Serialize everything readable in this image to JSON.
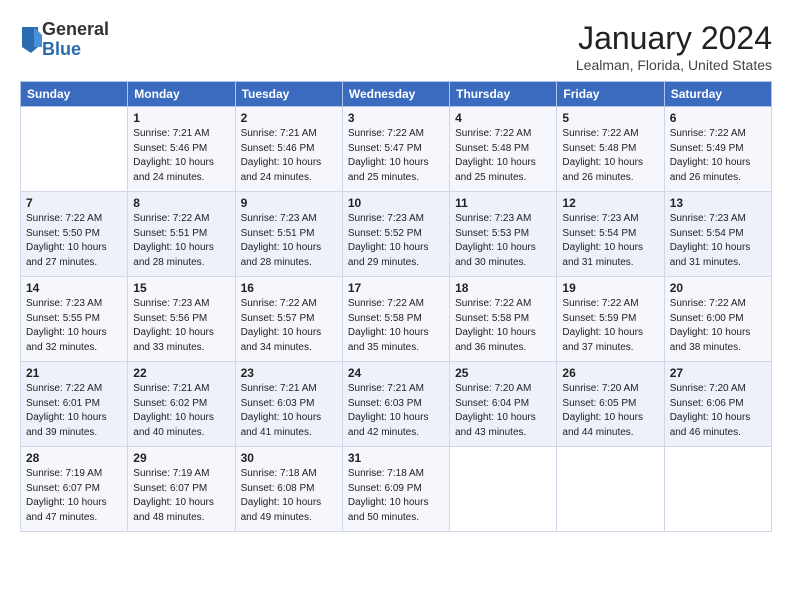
{
  "header": {
    "logo_general": "General",
    "logo_blue": "Blue",
    "month_title": "January 2024",
    "location": "Lealman, Florida, United States"
  },
  "days_of_week": [
    "Sunday",
    "Monday",
    "Tuesday",
    "Wednesday",
    "Thursday",
    "Friday",
    "Saturday"
  ],
  "weeks": [
    [
      {
        "day": "",
        "info": ""
      },
      {
        "day": "1",
        "info": "Sunrise: 7:21 AM\nSunset: 5:46 PM\nDaylight: 10 hours\nand 24 minutes."
      },
      {
        "day": "2",
        "info": "Sunrise: 7:21 AM\nSunset: 5:46 PM\nDaylight: 10 hours\nand 24 minutes."
      },
      {
        "day": "3",
        "info": "Sunrise: 7:22 AM\nSunset: 5:47 PM\nDaylight: 10 hours\nand 25 minutes."
      },
      {
        "day": "4",
        "info": "Sunrise: 7:22 AM\nSunset: 5:48 PM\nDaylight: 10 hours\nand 25 minutes."
      },
      {
        "day": "5",
        "info": "Sunrise: 7:22 AM\nSunset: 5:48 PM\nDaylight: 10 hours\nand 26 minutes."
      },
      {
        "day": "6",
        "info": "Sunrise: 7:22 AM\nSunset: 5:49 PM\nDaylight: 10 hours\nand 26 minutes."
      }
    ],
    [
      {
        "day": "7",
        "info": "Sunrise: 7:22 AM\nSunset: 5:50 PM\nDaylight: 10 hours\nand 27 minutes."
      },
      {
        "day": "8",
        "info": "Sunrise: 7:22 AM\nSunset: 5:51 PM\nDaylight: 10 hours\nand 28 minutes."
      },
      {
        "day": "9",
        "info": "Sunrise: 7:23 AM\nSunset: 5:51 PM\nDaylight: 10 hours\nand 28 minutes."
      },
      {
        "day": "10",
        "info": "Sunrise: 7:23 AM\nSunset: 5:52 PM\nDaylight: 10 hours\nand 29 minutes."
      },
      {
        "day": "11",
        "info": "Sunrise: 7:23 AM\nSunset: 5:53 PM\nDaylight: 10 hours\nand 30 minutes."
      },
      {
        "day": "12",
        "info": "Sunrise: 7:23 AM\nSunset: 5:54 PM\nDaylight: 10 hours\nand 31 minutes."
      },
      {
        "day": "13",
        "info": "Sunrise: 7:23 AM\nSunset: 5:54 PM\nDaylight: 10 hours\nand 31 minutes."
      }
    ],
    [
      {
        "day": "14",
        "info": "Sunrise: 7:23 AM\nSunset: 5:55 PM\nDaylight: 10 hours\nand 32 minutes."
      },
      {
        "day": "15",
        "info": "Sunrise: 7:23 AM\nSunset: 5:56 PM\nDaylight: 10 hours\nand 33 minutes."
      },
      {
        "day": "16",
        "info": "Sunrise: 7:22 AM\nSunset: 5:57 PM\nDaylight: 10 hours\nand 34 minutes."
      },
      {
        "day": "17",
        "info": "Sunrise: 7:22 AM\nSunset: 5:58 PM\nDaylight: 10 hours\nand 35 minutes."
      },
      {
        "day": "18",
        "info": "Sunrise: 7:22 AM\nSunset: 5:58 PM\nDaylight: 10 hours\nand 36 minutes."
      },
      {
        "day": "19",
        "info": "Sunrise: 7:22 AM\nSunset: 5:59 PM\nDaylight: 10 hours\nand 37 minutes."
      },
      {
        "day": "20",
        "info": "Sunrise: 7:22 AM\nSunset: 6:00 PM\nDaylight: 10 hours\nand 38 minutes."
      }
    ],
    [
      {
        "day": "21",
        "info": "Sunrise: 7:22 AM\nSunset: 6:01 PM\nDaylight: 10 hours\nand 39 minutes."
      },
      {
        "day": "22",
        "info": "Sunrise: 7:21 AM\nSunset: 6:02 PM\nDaylight: 10 hours\nand 40 minutes."
      },
      {
        "day": "23",
        "info": "Sunrise: 7:21 AM\nSunset: 6:03 PM\nDaylight: 10 hours\nand 41 minutes."
      },
      {
        "day": "24",
        "info": "Sunrise: 7:21 AM\nSunset: 6:03 PM\nDaylight: 10 hours\nand 42 minutes."
      },
      {
        "day": "25",
        "info": "Sunrise: 7:20 AM\nSunset: 6:04 PM\nDaylight: 10 hours\nand 43 minutes."
      },
      {
        "day": "26",
        "info": "Sunrise: 7:20 AM\nSunset: 6:05 PM\nDaylight: 10 hours\nand 44 minutes."
      },
      {
        "day": "27",
        "info": "Sunrise: 7:20 AM\nSunset: 6:06 PM\nDaylight: 10 hours\nand 46 minutes."
      }
    ],
    [
      {
        "day": "28",
        "info": "Sunrise: 7:19 AM\nSunset: 6:07 PM\nDaylight: 10 hours\nand 47 minutes."
      },
      {
        "day": "29",
        "info": "Sunrise: 7:19 AM\nSunset: 6:07 PM\nDaylight: 10 hours\nand 48 minutes."
      },
      {
        "day": "30",
        "info": "Sunrise: 7:18 AM\nSunset: 6:08 PM\nDaylight: 10 hours\nand 49 minutes."
      },
      {
        "day": "31",
        "info": "Sunrise: 7:18 AM\nSunset: 6:09 PM\nDaylight: 10 hours\nand 50 minutes."
      },
      {
        "day": "",
        "info": ""
      },
      {
        "day": "",
        "info": ""
      },
      {
        "day": "",
        "info": ""
      }
    ]
  ]
}
